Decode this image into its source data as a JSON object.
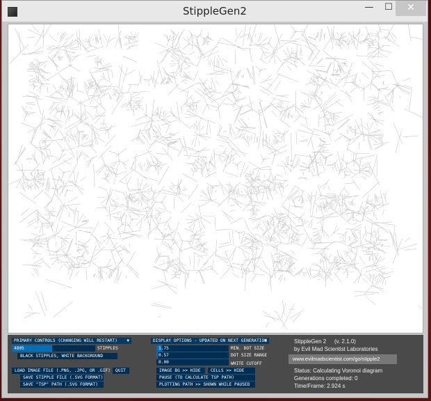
{
  "window": {
    "title": "StippleGen2",
    "minimize_glyph": "—",
    "maximize_glyph": "☐",
    "close_glyph": "✕"
  },
  "controls": {
    "primary_dropdown": "PRIMARY CONTROLS (CHANGING WILL RESTART)",
    "stipples_value": "4805",
    "stipples_fraction": 0.48,
    "stipples_label": "STIPPLES",
    "color_mode_button": "BLACK STIPPLES, WHITE BACKGROUND",
    "load_button": "LOAD IMAGE FILE (.PNG, .JPG, OR .GIF)",
    "quit_button": "QUIT",
    "save_svg_button": "SAVE STIPPLE FILE (.SVG FORMAT)",
    "save_tsp_button": "SAVE \"TSP\" PATH (.SVG FORMAT)",
    "display_dropdown": "DISPLAY OPTIONS - UPDATED ON NEXT GENERATION",
    "min_dot_value": "1.75",
    "min_dot_fraction": 0.08,
    "min_dot_label": "MIN. DOT SIZE",
    "dot_range_value": "0.57",
    "dot_range_fraction": 0.02,
    "dot_range_label": "DOT SIZE RANGE",
    "white_cutoff_value": "0.00",
    "white_cutoff_fraction": 0.0,
    "white_cutoff_label": "WHITE CUTOFF",
    "image_bg_button": "IMAGE BG >> HIDE",
    "cells_button": "CELLS >> HIDE",
    "pause_button": "PAUSE (TO CALCULATE TSP PATH)",
    "plotting_button": "PLOTTING PATH >> SHOWN WHILE PAUSED"
  },
  "info": {
    "app_name": "StippleGen 2",
    "version": "(v. 2.1.0)",
    "by": "by Evil Mad Scientist Laboratories",
    "url": "www.evilmadscientist.com/go/stipple2",
    "status": "Status: Calculating Voronoi diagram",
    "generations": "Generations completed: 0",
    "time_frame": "Time/Frame: 2.924 s"
  },
  "colors": {
    "panel_bg": "#4a4a4a",
    "control_dark": "#002d52",
    "control_header": "#003b67",
    "control_fill": "#016fb9",
    "cell_stroke": "#c8c8c8"
  }
}
